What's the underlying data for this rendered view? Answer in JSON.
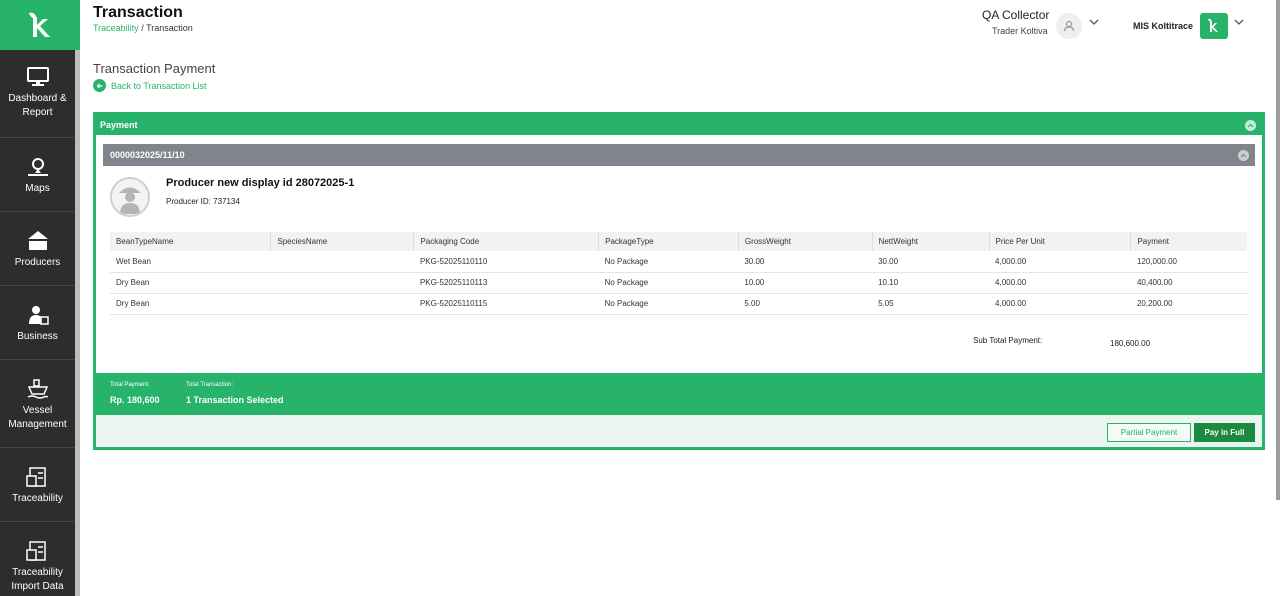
{
  "colors": {
    "brand": "#27b36a",
    "sidebar": "#2d2d2d",
    "primary_button": "#1b8a3e",
    "subheader": "#80858b"
  },
  "sidebar": {
    "items": [
      {
        "label": "Dashboard & Report",
        "icon": "monitor-icon"
      },
      {
        "label": "Maps",
        "icon": "map-pin-icon"
      },
      {
        "label": "Producers",
        "icon": "producers-icon"
      },
      {
        "label": "Business",
        "icon": "business-icon"
      },
      {
        "label": "Vessel Management",
        "icon": "vessel-icon"
      },
      {
        "label": "Traceability",
        "icon": "traceability-icon"
      },
      {
        "label": "Traceability Import Data",
        "icon": "import-data-icon"
      }
    ]
  },
  "header": {
    "title": "Transaction",
    "breadcrumb_link": "Traceability",
    "breadcrumb_sep": "/",
    "breadcrumb_current": "Transaction",
    "user_name": "QA Collector",
    "user_role": "Trader Koltiva",
    "org_name": "MIS Koltitrace"
  },
  "page": {
    "title": "Transaction Payment",
    "back_label": "Back to Transaction List"
  },
  "payment": {
    "panel_title": "Payment",
    "transaction_id": "0000032025/11/10",
    "producer_name": "Producer new display id 28072025-1",
    "producer_id": "Producer ID: 737134",
    "columns": [
      "BeanTypeName",
      "SpeciesName",
      "Packaging Code",
      "PackageType",
      "GrossWeight",
      "NettWeight",
      "Price Per Unit",
      "Payment"
    ],
    "rows": [
      [
        "Wet Bean",
        "",
        "PKG-52025110110",
        "No Package",
        "30.00",
        "30.00",
        "4,000.00",
        "120,000.00"
      ],
      [
        "Dry Bean",
        "",
        "PKG-52025110113",
        "No Package",
        "10.00",
        "10.10",
        "4,000.00",
        "40,400.00"
      ],
      [
        "Dry Bean",
        "",
        "PKG-52025110115",
        "No Package",
        "5.00",
        "5.05",
        "4,000.00",
        "20,200.00"
      ]
    ],
    "subtotal_label": "Sub Total Payment:",
    "subtotal_value": "180,600.00",
    "total_payment_label": "Total Payment:",
    "total_payment_value": "Rp. 180,600",
    "total_transaction_label": "Total Transaction:",
    "total_transaction_value": "1 Transaction Selected",
    "partial_button": "Partial Payment",
    "full_button": "Pay in Full"
  }
}
